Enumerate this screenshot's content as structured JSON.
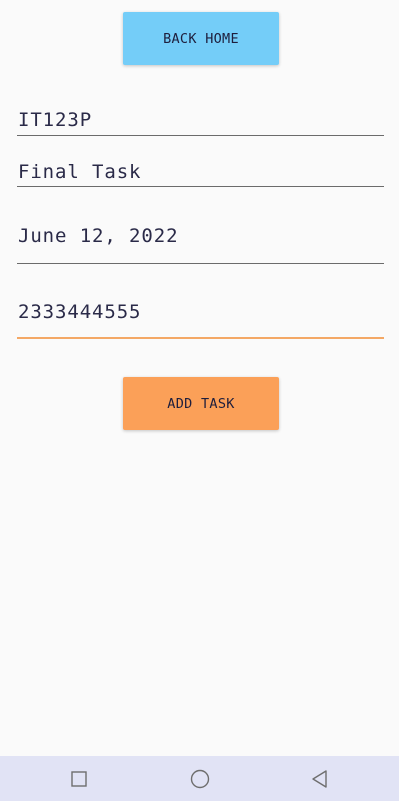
{
  "buttons": {
    "back_home": "BACK HOME",
    "add_task": "ADD TASK"
  },
  "form": {
    "course_code": "IT123P",
    "task_name": "Final Task",
    "due_date": "June 12, 2022",
    "phone_number": "2333444555"
  },
  "colors": {
    "back_home_button": "#74cdf8",
    "add_task_button": "#fba058",
    "focused_underline": "#f4a865",
    "nav_bar": "#e1e3f5"
  },
  "nav": {
    "recents_icon": "square-icon",
    "home_icon": "circle-icon",
    "back_icon": "triangle-back-icon"
  }
}
